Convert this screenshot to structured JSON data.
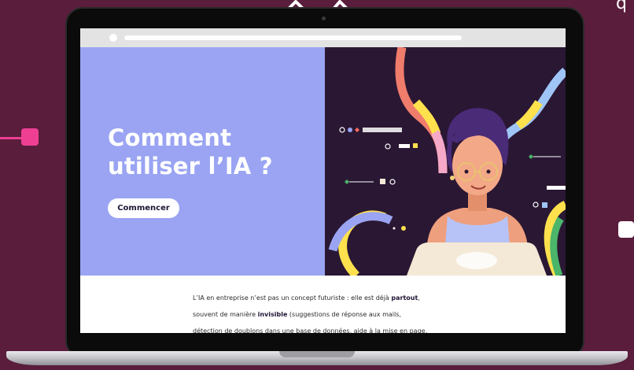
{
  "hero": {
    "title_line1": "Comment",
    "title_line2": "utiliser l’IA ?",
    "cta_label": "Commencer"
  },
  "article": {
    "line1": {
      "before": "L’IA en entreprise n’est pas un concept futuriste : elle est déjà ",
      "bold": "partout",
      "after": ","
    },
    "line2": {
      "before": "souvent de manière ",
      "bold": "invisible",
      "after": " (suggestions de réponse aux mails,"
    },
    "line3": "détection de doublons dans une base de données, aide à la mise en page,"
  },
  "decor": {
    "corner_char": "q"
  },
  "colors": {
    "page_background": "#5a1d3c",
    "hero_left": "#9aa4f2",
    "hero_right": "#2a1733",
    "accent_pink": "#ee3f93",
    "text_dark": "#1f1535"
  },
  "icons": {
    "top_arrows": "up-arrows-icon",
    "illustration": "woman-with-laptop-illustration"
  }
}
